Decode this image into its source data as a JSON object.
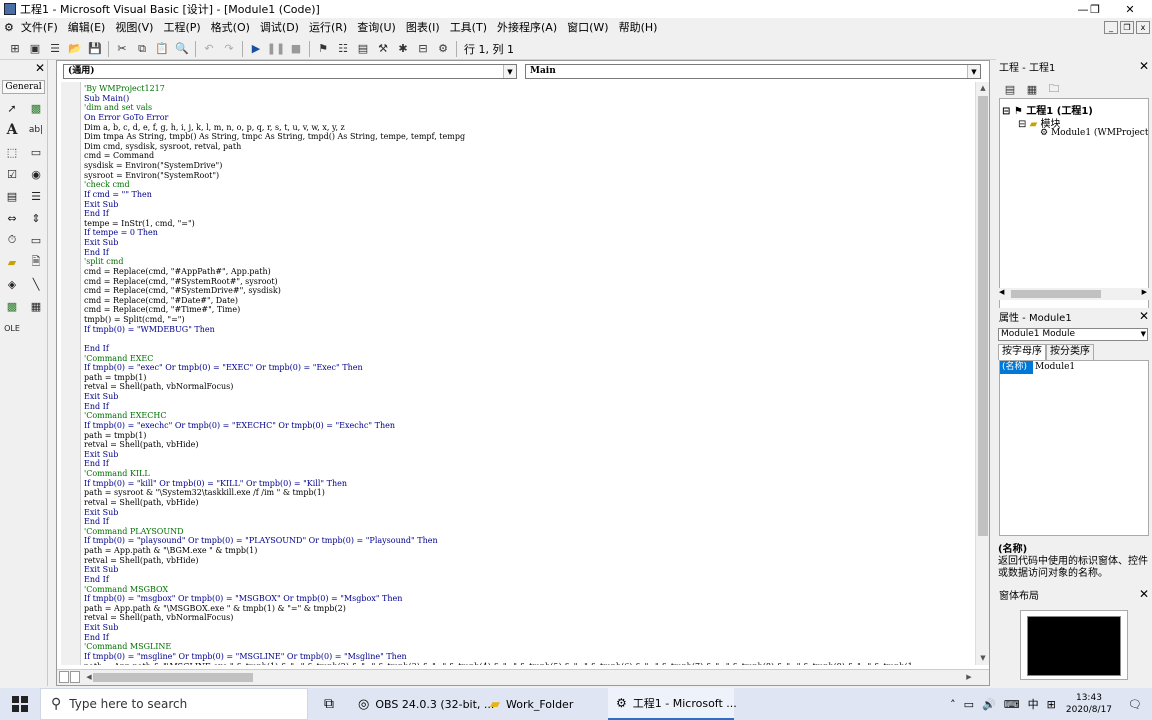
{
  "window": {
    "title": "工程1 - Microsoft Visual Basic [设计] - [Module1 (Code)]",
    "minimize": "—",
    "restore": "❐",
    "close": "✕"
  },
  "menu": {
    "items": [
      "文件(F)",
      "编辑(E)",
      "视图(V)",
      "工程(P)",
      "格式(O)",
      "调试(D)",
      "运行(R)",
      "查询(U)",
      "图表(I)",
      "工具(T)",
      "外接程序(A)",
      "窗口(W)",
      "帮助(H)"
    ],
    "mdi_min": "_",
    "mdi_restore": "❐",
    "mdi_close": "x"
  },
  "toolbar": {
    "position": "行 1, 列 1",
    "icons": [
      "add-project-icon",
      "add-form-icon",
      "menu-editor-icon",
      "open-icon",
      "save-icon",
      "cut-icon",
      "copy-icon",
      "paste-icon",
      "find-icon",
      "undo-icon",
      "redo-icon",
      "run-icon",
      "pause-icon",
      "stop-icon",
      "project-explorer-icon",
      "properties-icon",
      "form-layout-icon",
      "object-browser-icon",
      "toolbox-icon",
      "data-view-icon",
      "component-manager-icon"
    ]
  },
  "toolbox": {
    "close": "✕",
    "tab_label": "General"
  },
  "code_window": {
    "object_combo": "(通用)",
    "procedure_combo": "Main",
    "lines": [
      [
        "cm",
        "'By WMProject1217"
      ],
      [
        "kw",
        "Sub Main()"
      ],
      [
        "cm",
        "'dim and set vals"
      ],
      [
        "kw",
        "On Error GoTo Error"
      ],
      [
        "",
        "Dim a, b, c, d, e, f, g, h, i, j, k, l, m, n, o, p, q, r, s, t, u, v, w, x, y, z"
      ],
      [
        "",
        "Dim tmpa As String, tmpb() As String, tmpc As String, tmpd() As String, tempe, tempf, tempg"
      ],
      [
        "",
        "Dim cmd, sysdisk, sysroot, retval, path"
      ],
      [
        "",
        "cmd = Command"
      ],
      [
        "",
        "sysdisk = Environ(\"SystemDrive\")"
      ],
      [
        "",
        "sysroot = Environ(\"SystemRoot\")"
      ],
      [
        "cm",
        "'check cmd"
      ],
      [
        "kw",
        "If cmd = \"\" Then"
      ],
      [
        "kw",
        "Exit Sub"
      ],
      [
        "kw",
        "End If"
      ],
      [
        "",
        "tempe = InStr(1, cmd, \"=\")"
      ],
      [
        "kw",
        "If tempe = 0 Then"
      ],
      [
        "kw",
        "Exit Sub"
      ],
      [
        "kw",
        "End If"
      ],
      [
        "cm",
        "'split cmd"
      ],
      [
        "",
        "cmd = Replace(cmd, \"#AppPath#\", App.path)"
      ],
      [
        "",
        "cmd = Replace(cmd, \"#SystemRoot#\", sysroot)"
      ],
      [
        "",
        "cmd = Replace(cmd, \"#SystemDrive#\", sysdisk)"
      ],
      [
        "",
        "cmd = Replace(cmd, \"#Date#\", Date)"
      ],
      [
        "",
        "cmd = Replace(cmd, \"#Time#\", Time)"
      ],
      [
        "",
        "tmpb() = Split(cmd, \"=\")"
      ],
      [
        "kw",
        "If tmpb(0) = \"WMDEBUG\" Then"
      ],
      [
        "",
        ""
      ],
      [
        "kw",
        "End If"
      ],
      [
        "cm",
        "'Command EXEC"
      ],
      [
        "kw",
        "If tmpb(0) = \"exec\" Or tmpb(0) = \"EXEC\" Or tmpb(0) = \"Exec\" Then"
      ],
      [
        "",
        "path = tmpb(1)"
      ],
      [
        "",
        "retval = Shell(path, vbNormalFocus)"
      ],
      [
        "kw",
        "Exit Sub"
      ],
      [
        "kw",
        "End If"
      ],
      [
        "cm",
        "'Command EXECHC"
      ],
      [
        "kw",
        "If tmpb(0) = \"exechc\" Or tmpb(0) = \"EXECHC\" Or tmpb(0) = \"Exechc\" Then"
      ],
      [
        "",
        "path = tmpb(1)"
      ],
      [
        "",
        "retval = Shell(path, vbHide)"
      ],
      [
        "kw",
        "Exit Sub"
      ],
      [
        "kw",
        "End If"
      ],
      [
        "cm",
        "'Command KILL"
      ],
      [
        "kw",
        "If tmpb(0) = \"kill\" Or tmpb(0) = \"KILL\" Or tmpb(0) = \"Kill\" Then"
      ],
      [
        "",
        "path = sysroot & \"\\System32\\taskkill.exe /f /im \" & tmpb(1)"
      ],
      [
        "",
        "retval = Shell(path, vbHide)"
      ],
      [
        "kw",
        "Exit Sub"
      ],
      [
        "kw",
        "End If"
      ],
      [
        "cm",
        "'Command PLAYSOUND"
      ],
      [
        "kw",
        "If tmpb(0) = \"playsound\" Or tmpb(0) = \"PLAYSOUND\" Or tmpb(0) = \"Playsound\" Then"
      ],
      [
        "",
        "path = App.path & \"\\BGM.exe \" & tmpb(1)"
      ],
      [
        "",
        "retval = Shell(path, vbHide)"
      ],
      [
        "kw",
        "Exit Sub"
      ],
      [
        "kw",
        "End If"
      ],
      [
        "cm",
        "'Command MSGBOX"
      ],
      [
        "kw",
        "If tmpb(0) = \"msgbox\" Or tmpb(0) = \"MSGBOX\" Or tmpb(0) = \"Msgbox\" Then"
      ],
      [
        "",
        "path = App.path & \"\\MSGBOX.exe \" & tmpb(1) & \"=\" & tmpb(2)"
      ],
      [
        "",
        "retval = Shell(path, vbNormalFocus)"
      ],
      [
        "kw",
        "Exit Sub"
      ],
      [
        "kw",
        "End If"
      ],
      [
        "cm",
        "'Command MSGLINE"
      ],
      [
        "kw",
        "If tmpb(0) = \"msgline\" Or tmpb(0) = \"MSGLINE\" Or tmpb(0) = \"Msgline\" Then"
      ],
      [
        "",
        "path = App.path & \"\\MSGLINE.exe \" & tmpb(1) & \"=\" & tmpb(2) & \"=\" & tmpb(3) & \"=\" & tmpb(4) & \"=\" & tmpb(5) & \"=\" & tmpb(6) & \"=\" & tmpb(7) & \"=\" & tmpb(8) & \"=\" & tmpb(9) & \"=\" & tmpb(1"
      ]
    ]
  },
  "project_panel": {
    "title": "工程 - 工程1",
    "close": "✕",
    "tree": {
      "project": "工程1 (工程1)",
      "folder": "模块",
      "module": "Module1 (WMProject"
    }
  },
  "properties_panel": {
    "title": "属性 - Module1",
    "close": "✕",
    "object_combo": "Module1 Module",
    "tabs": [
      "按字母序",
      "按分类序"
    ],
    "row_key": "(名称)",
    "row_value": "Module1",
    "desc_title": "(名称)",
    "desc_text": "返回代码中使用的标识窗体、控件或数据访问对象的名称。"
  },
  "layout_panel": {
    "title": "窗体布局",
    "close": "✕"
  },
  "taskbar": {
    "search_placeholder": "Type here to search",
    "apps": [
      "OBS 24.0.3 (32-bit, ...",
      "Work_Folder",
      "工程1 - Microsoft ..."
    ],
    "ime": "中",
    "time": "13:43",
    "date": "2020/8/17"
  }
}
